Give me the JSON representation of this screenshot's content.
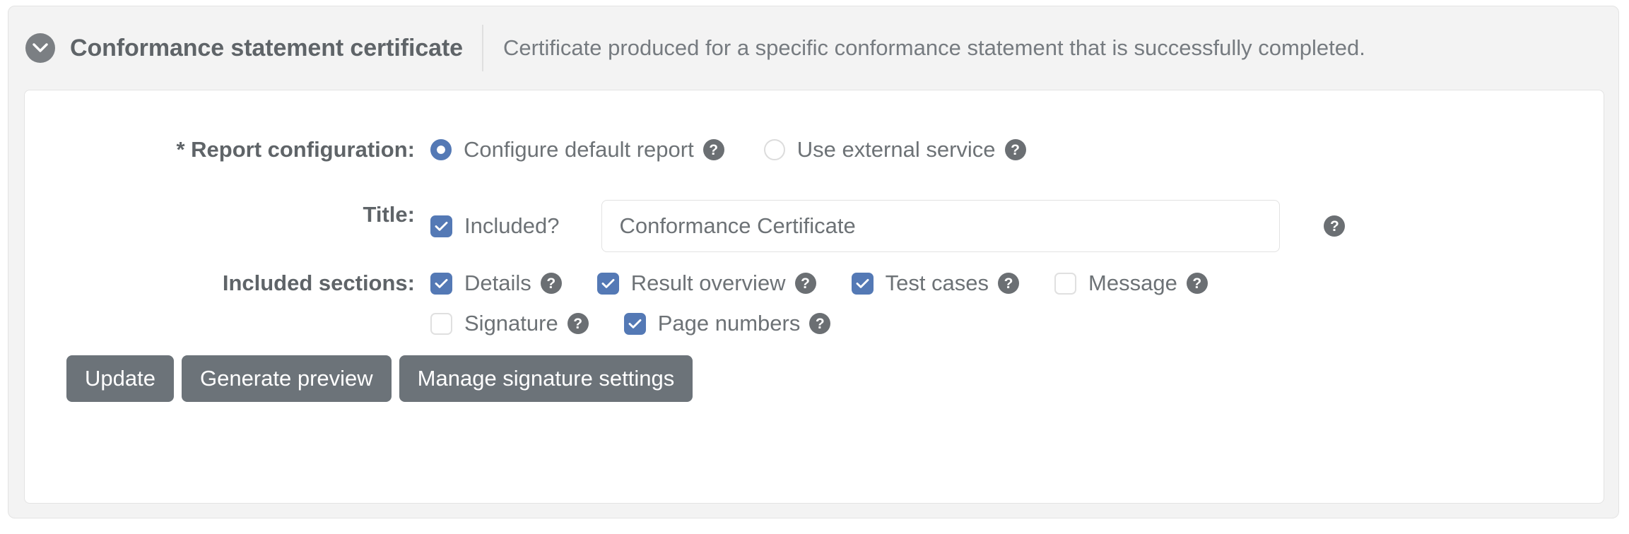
{
  "panel": {
    "collapse_icon": "chevron-down-icon",
    "title": "Conformance statement certificate",
    "description": "Certificate produced for a specific conformance statement that is successfully completed."
  },
  "form": {
    "report_configuration": {
      "label": "* Report configuration:",
      "options": [
        {
          "label": "Configure default report",
          "selected": true,
          "help": "?"
        },
        {
          "label": "Use external service",
          "selected": false,
          "help": "?"
        }
      ]
    },
    "title_field": {
      "label": "Title:",
      "checkbox_label": "Included?",
      "checked": true,
      "value": "Conformance Certificate",
      "placeholder": "",
      "help": "?"
    },
    "included_sections": {
      "label": "Included sections:",
      "row1": [
        {
          "label": "Details",
          "checked": true,
          "help": "?"
        },
        {
          "label": "Result overview",
          "checked": true,
          "help": "?"
        },
        {
          "label": "Test cases",
          "checked": true,
          "help": "?"
        },
        {
          "label": "Message",
          "checked": false,
          "help": "?"
        }
      ],
      "row2": [
        {
          "label": "Signature",
          "checked": false,
          "help": "?"
        },
        {
          "label": "Page numbers",
          "checked": true,
          "help": "?"
        }
      ]
    }
  },
  "buttons": [
    {
      "label": "Update"
    },
    {
      "label": "Generate preview"
    },
    {
      "label": "Manage signature settings"
    }
  ],
  "colors": {
    "accent": "#5479b5",
    "button": "#6c7379",
    "label_text": "#5f6468",
    "body_text": "#6d7276",
    "help_bg": "#6b6f73",
    "header_bg": "#f3f3f3",
    "border": "#e3e3e3"
  }
}
